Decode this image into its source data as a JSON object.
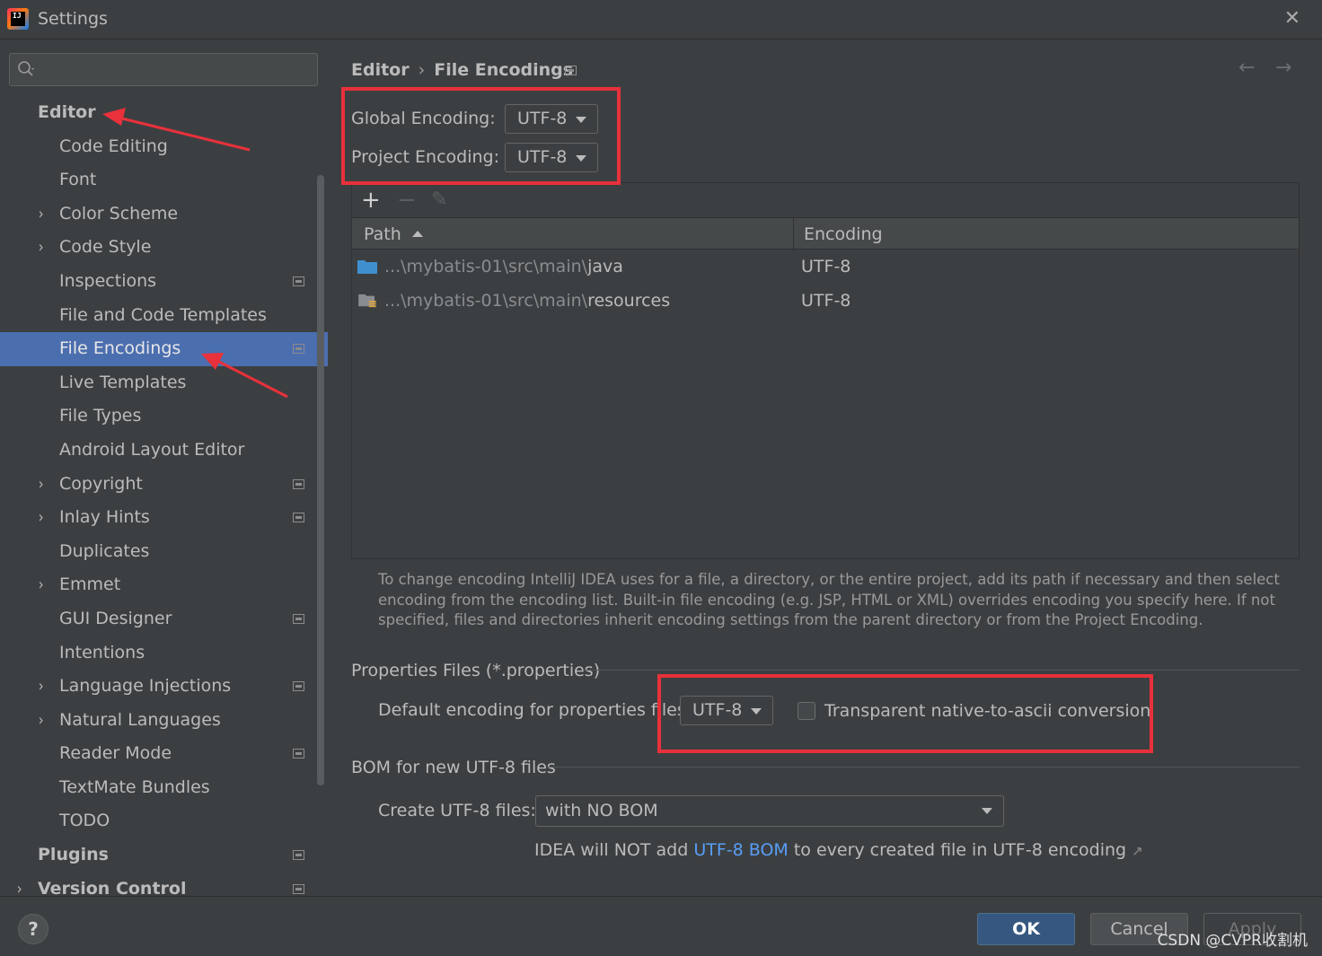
{
  "window": {
    "title": "Settings",
    "close_glyph": "✕",
    "app_icon_text": "IJ"
  },
  "search": {
    "placeholder": ""
  },
  "sidebar": {
    "items": [
      {
        "label": "Editor",
        "bold": true
      },
      {
        "label": "Code Editing"
      },
      {
        "label": "Font"
      },
      {
        "label": "Color Scheme",
        "expandable": true
      },
      {
        "label": "Code Style",
        "expandable": true
      },
      {
        "label": "Inspections",
        "project_icon": true
      },
      {
        "label": "File and Code Templates"
      },
      {
        "label": "File Encodings",
        "selected": true,
        "project_icon": true
      },
      {
        "label": "Live Templates"
      },
      {
        "label": "File Types"
      },
      {
        "label": "Android Layout Editor"
      },
      {
        "label": "Copyright",
        "expandable": true,
        "project_icon": true
      },
      {
        "label": "Inlay Hints",
        "expandable": true,
        "project_icon": true
      },
      {
        "label": "Duplicates"
      },
      {
        "label": "Emmet",
        "expandable": true
      },
      {
        "label": "GUI Designer",
        "project_icon": true
      },
      {
        "label": "Intentions"
      },
      {
        "label": "Language Injections",
        "expandable": true,
        "project_icon": true
      },
      {
        "label": "Natural Languages",
        "expandable": true
      },
      {
        "label": "Reader Mode",
        "project_icon": true
      },
      {
        "label": "TextMate Bundles"
      },
      {
        "label": "TODO"
      },
      {
        "label": "Plugins",
        "bold": true,
        "project_icon": true
      },
      {
        "label": "Version Control",
        "bold": true,
        "expandable": true,
        "project_icon": true
      }
    ]
  },
  "breadcrumb": {
    "parent": "Editor",
    "separator": "›",
    "current": "File Encodings"
  },
  "nav": {
    "back": "←",
    "forward": "→"
  },
  "encoding": {
    "global_label": "Global Encoding:",
    "global_value": "UTF-8",
    "project_label": "Project Encoding:",
    "project_value": "UTF-8"
  },
  "toolbar": {
    "add": "+",
    "remove": "−",
    "edit": "✎"
  },
  "table": {
    "columns": [
      "Path",
      "Encoding"
    ],
    "rows": [
      {
        "prefix": "...\\mybatis-01\\src\\main\\",
        "name": "java",
        "encoding": "UTF-8",
        "icon": "source-folder-icon"
      },
      {
        "prefix": "...\\mybatis-01\\src\\main\\",
        "name": "resources",
        "encoding": "UTF-8",
        "icon": "resources-folder-icon"
      }
    ]
  },
  "help_text": "To change encoding IntelliJ IDEA uses for a file, a directory, or the entire project, add its path if necessary and then select encoding from the encoding list. Built-in file encoding (e.g. JSP, HTML or XML) overrides encoding you specify here. If not specified, files and directories inherit encoding settings from the parent directory or from the Project Encoding.",
  "properties": {
    "section_title": "Properties Files (*.properties)",
    "default_label": "Default encoding for properties files:",
    "default_value": "UTF-8",
    "transparent_label": "Transparent native-to-ascii conversion",
    "transparent_checked": false
  },
  "bom": {
    "section_title": "BOM for new UTF-8 files",
    "create_label": "Create UTF-8 files:",
    "create_value": "with NO BOM",
    "note_before": "IDEA will NOT add ",
    "note_link": "UTF-8 BOM",
    "note_after": " to every created file in UTF-8 encoding",
    "ext_glyph": "↗"
  },
  "buttons": {
    "help": "?",
    "ok": "OK",
    "cancel": "Cancel",
    "apply": "Apply"
  },
  "watermark": "CSDN @CVPR收割机",
  "colors": {
    "selection": "#4b6eaf",
    "annotation_red": "#e8313b",
    "link": "#589df6",
    "ok_button": "#365880"
  }
}
